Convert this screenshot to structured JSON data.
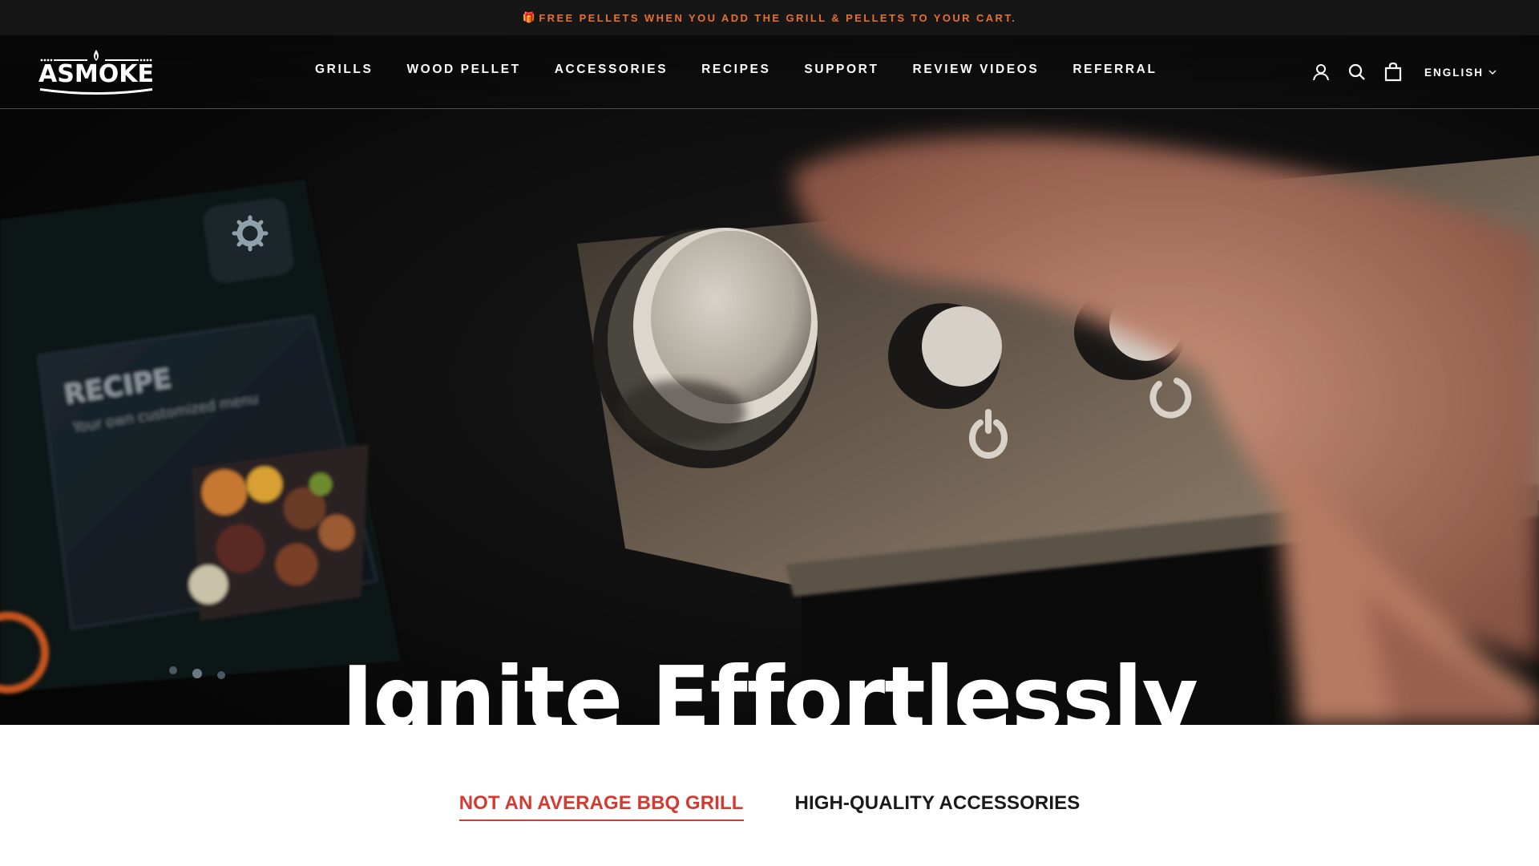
{
  "announcement": {
    "icon": "gift-icon",
    "text": "FREE PELLETS WHEN YOU ADD THE GRILL & PELLETS TO YOUR CART.",
    "color": "#e8702a"
  },
  "header": {
    "logo_text": "ASMOKE",
    "nav": [
      "GRILLS",
      "WOOD PELLET",
      "ACCESSORIES",
      "RECIPES",
      "SUPPORT",
      "REVIEW VIDEOS",
      "REFERRAL"
    ],
    "icons": [
      "account-icon",
      "search-icon",
      "cart-icon"
    ],
    "language": "ENGLISH"
  },
  "hero": {
    "title": "Ignite Effortlessly",
    "screen_text": {
      "heading": "RECIPE",
      "subheading": "Your own customized menu"
    },
    "slides_total": 3,
    "active_slide": 2
  },
  "tabs": {
    "items": [
      "NOT AN AVERAGE BBQ GRILL",
      "HIGH-QUALITY ACCESSORIES"
    ],
    "active_index": 0,
    "accent_color": "#d33a32"
  }
}
